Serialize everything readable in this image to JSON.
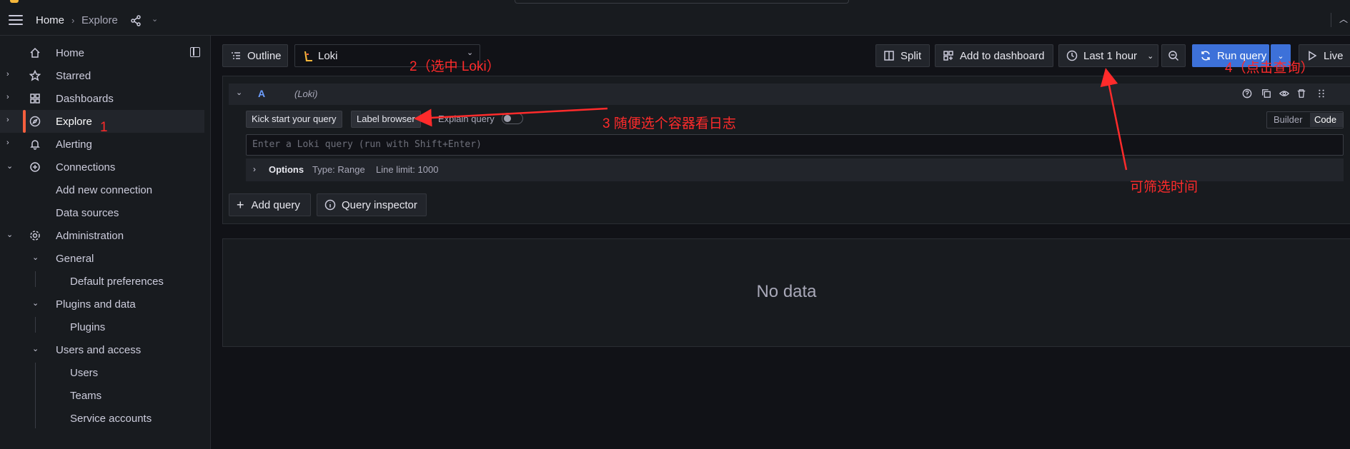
{
  "breadcrumb": {
    "home": "Home",
    "separator": "›",
    "current": "Explore"
  },
  "sidebar": {
    "items": [
      {
        "label": "Home"
      },
      {
        "label": "Starred"
      },
      {
        "label": "Dashboards"
      },
      {
        "label": "Explore"
      },
      {
        "label": "Alerting"
      },
      {
        "label": "Connections"
      },
      {
        "label": "Add new connection"
      },
      {
        "label": "Data sources"
      },
      {
        "label": "Administration"
      },
      {
        "label": "General"
      },
      {
        "label": "Default preferences"
      },
      {
        "label": "Plugins and data"
      },
      {
        "label": "Plugins"
      },
      {
        "label": "Users and access"
      },
      {
        "label": "Users"
      },
      {
        "label": "Teams"
      },
      {
        "label": "Service accounts"
      }
    ]
  },
  "toolbar": {
    "outline": "Outline",
    "datasource": "Loki",
    "split": "Split",
    "add_to_dashboard": "Add to dashboard",
    "time_range": "Last 1 hour",
    "run_query": "Run query",
    "live": "Live"
  },
  "query": {
    "ref_id": "A",
    "datasource_label": "(Loki)",
    "kick_start": "Kick start your query",
    "label_browser": "Label browser",
    "explain_query": "Explain query",
    "placeholder": "Enter a Loki query (run with Shift+Enter)",
    "options_label": "Options",
    "options_type": "Type: Range",
    "options_limit": "Line limit: 1000",
    "mode_builder": "Builder",
    "mode_code": "Code",
    "add_query": "Add query",
    "query_inspector": "Query inspector"
  },
  "results": {
    "empty": "No data"
  },
  "annotations": {
    "a1": "1",
    "a2": "2（选中 Loki）",
    "a3": "3  随便选个容器看日志",
    "a4": "4（点击查询）",
    "a5": "可筛选时间"
  },
  "colors": {
    "accent": "#3d71d9",
    "active": "#f55f3e",
    "annotation": "#ff2b2b"
  }
}
